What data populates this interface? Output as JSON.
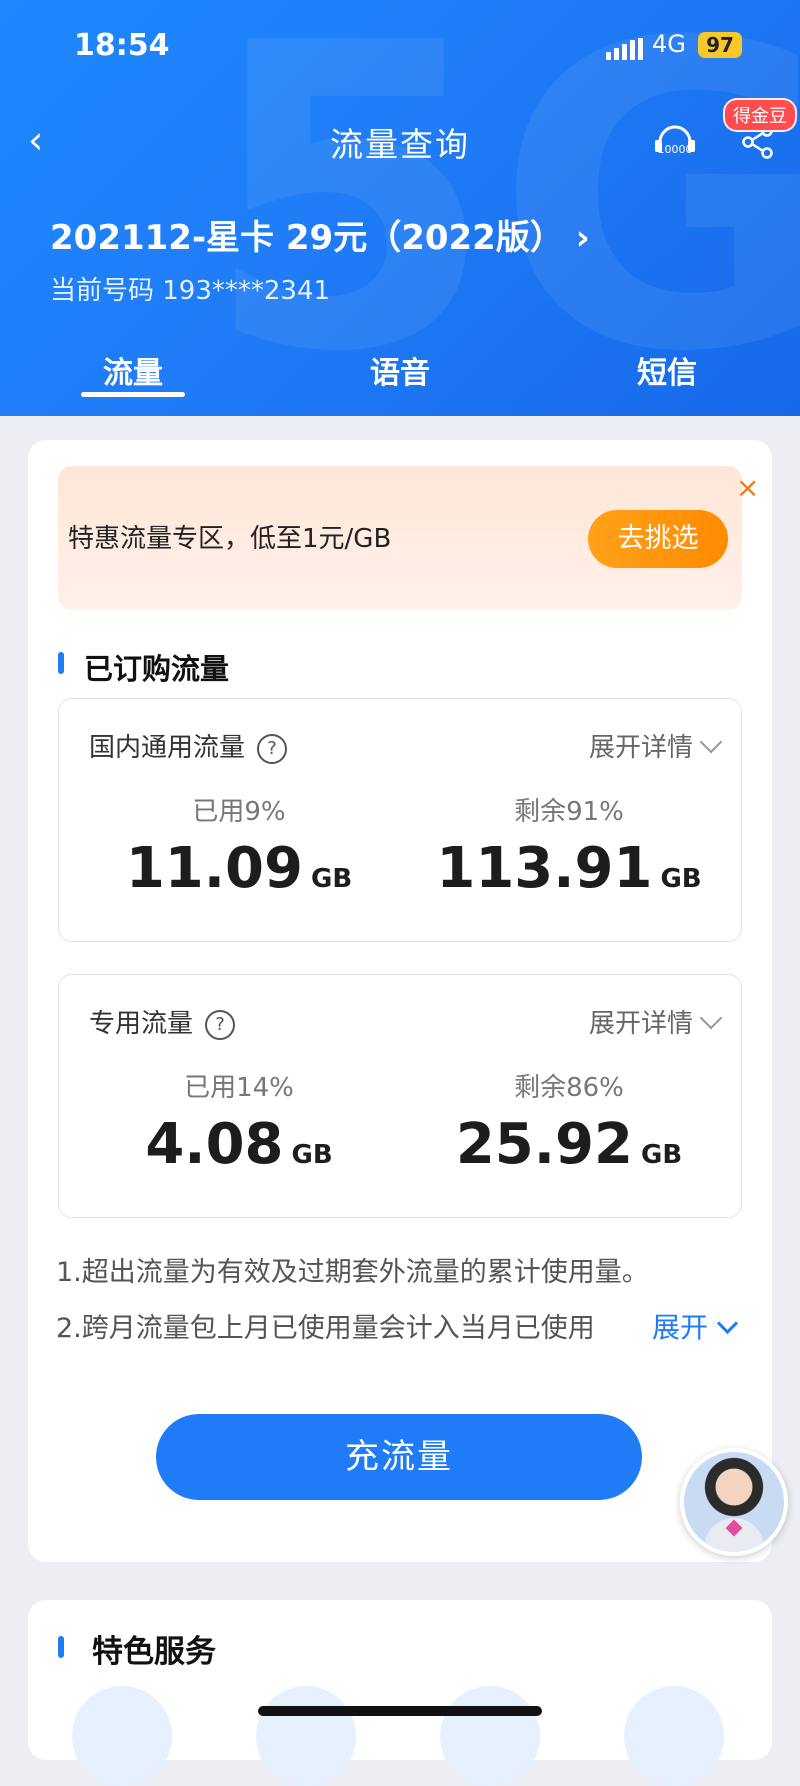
{
  "status_bar": {
    "time": "18:54",
    "network": "4G",
    "battery": "97"
  },
  "header": {
    "back_label": "‹",
    "title": "流量查询",
    "service_label": "10000",
    "badge": "得金豆",
    "plan_name": "202112-星卡 29元（2022版）",
    "phone_line": "当前号码 193****2341"
  },
  "tabs": [
    {
      "label": "流量",
      "active": true
    },
    {
      "label": "语音",
      "active": false
    },
    {
      "label": "短信",
      "active": false
    }
  ],
  "promo": {
    "text": "特惠流量专区，低至1元/GB",
    "button": "去挑选",
    "close": "×"
  },
  "section_title": "已订购流量",
  "boxes": [
    {
      "name": "国内通用流量",
      "expand": "展开详情",
      "used_label": "已用9%",
      "used_value": "11.09",
      "remain_label": "剩余91%",
      "remain_value": "113.91",
      "unit": "GB",
      "used_pct": 9
    },
    {
      "name": "专用流量",
      "expand": "展开详情",
      "used_label": "已用14%",
      "used_value": "4.08",
      "remain_label": "剩余86%",
      "remain_value": "25.92",
      "unit": "GB",
      "used_pct": 14
    }
  ],
  "notes": [
    "1.超出流量为有效及过期套外流量的累计使用量。",
    "2.跨月流量包上月已使用量会计入当月已使用"
  ],
  "notes_more": "展开",
  "recharge_button": "充流量",
  "special_title": "特色服务",
  "colors": {
    "primary": "#1f7cf6",
    "promo_accent": "#ff8a00",
    "badge_red": "#ff4d4f"
  }
}
